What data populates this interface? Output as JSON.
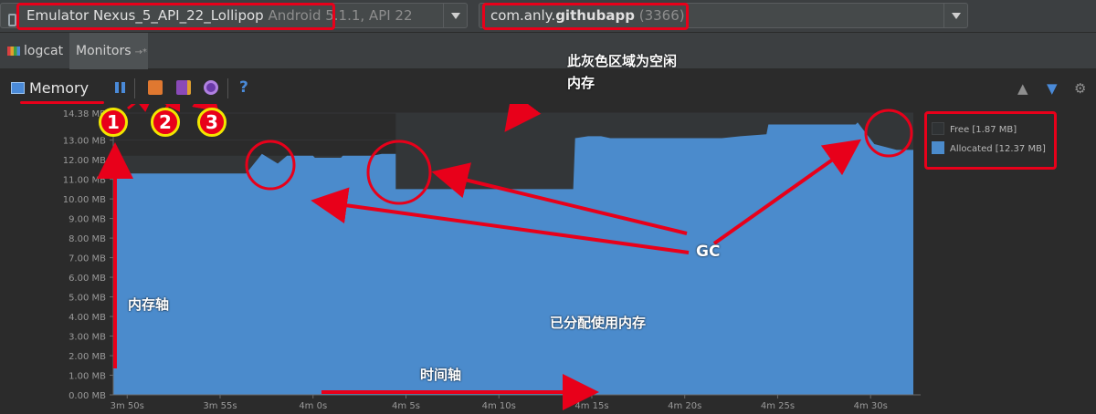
{
  "device_combo": {
    "name": "Emulator Nexus_5_API_22_Lollipop",
    "version": "Android 5.1.1, API 22"
  },
  "process_combo": {
    "prefix": "com.anly.",
    "bold": "githubapp",
    "pid": "(3366)"
  },
  "tabs": {
    "logcat": "logcat",
    "monitors": "Monitors",
    "monitors_pin": "→*"
  },
  "memory_label": "Memory",
  "help_label": "?",
  "legend": {
    "free": "Free [1.87 MB]",
    "allocated": "Allocated [12.37 MB]"
  },
  "annotations": {
    "idle_line1": "此灰色区域为空闲",
    "idle_line2": "内存",
    "gc": "GC",
    "memory_axis": "内存轴",
    "allocated_memory": "已分配使用内存",
    "time_axis": "时间轴",
    "circle_1": "1",
    "circle_2": "2",
    "circle_3": "3"
  },
  "colors": {
    "free": "#333638",
    "allocated": "#4b8bcc",
    "highlight": "#e8001a",
    "background": "#2b2b2b"
  },
  "chart_data": {
    "type": "area",
    "ylim": [
      0,
      14.38
    ],
    "yticks": [
      "0.00 MB",
      "1.00 MB",
      "2.00 MB",
      "3.00 MB",
      "4.00 MB",
      "5.00 MB",
      "6.00 MB",
      "7.00 MB",
      "8.00 MB",
      "9.00 MB",
      "10.00 MB",
      "11.00 MB",
      "12.00 MB",
      "13.00 MB",
      "14.38 MB"
    ],
    "ytick_values": [
      0,
      1,
      2,
      3,
      4,
      5,
      6,
      7,
      8,
      9,
      10,
      11,
      12,
      13,
      14.38
    ],
    "xlim": [
      -10.75,
      32.3
    ],
    "xticks": [
      "3m 50s",
      "3m 55s",
      "4m 0s",
      "4m 5s",
      "4m 10s",
      "4m 15s",
      "4m 20s",
      "4m 25s",
      "4m 30s"
    ],
    "xtick_values": [
      -10,
      -5,
      0,
      5,
      10,
      15,
      20,
      25,
      30
    ],
    "series": [
      {
        "name": "Free",
        "x": [
          -10.75,
          4.45,
          4.45,
          14.1,
          14.1,
          32.3
        ],
        "values": [
          12.2,
          12.2,
          14.38,
          14.38,
          14.38,
          14.38
        ]
      },
      {
        "name": "Allocated",
        "x": [
          -10.75,
          -10.4,
          -7.8,
          -5.8,
          -3.6,
          -2.75,
          -1.9,
          -1.4,
          -1.0,
          0.0,
          0.1,
          1.5,
          1.6,
          2.2,
          2.7,
          3.2,
          3.7,
          4.45,
          4.45,
          6.5,
          6.6,
          7.5,
          8.8,
          8.9,
          10.0,
          10.1,
          11.2,
          11.3,
          12.3,
          12.4,
          14.0,
          14.1,
          14.8,
          15.5,
          16.0,
          17.0,
          18.0,
          19.0,
          20.0,
          21.0,
          22.0,
          23.0,
          24.4,
          24.5,
          25.0,
          26.0,
          27.0,
          28.0,
          29.2,
          29.3,
          30.2,
          31.4,
          31.5,
          32.3
        ],
        "values": [
          12.0,
          11.3,
          11.3,
          11.3,
          11.3,
          12.3,
          11.8,
          12.2,
          12.2,
          12.2,
          12.1,
          12.1,
          12.2,
          12.2,
          12.2,
          12.2,
          12.3,
          12.3,
          10.5,
          10.5,
          10.5,
          10.5,
          10.5,
          10.5,
          10.5,
          10.5,
          10.5,
          10.5,
          10.5,
          10.5,
          10.5,
          13.1,
          13.2,
          13.2,
          13.1,
          13.1,
          13.1,
          13.1,
          13.1,
          13.1,
          13.1,
          13.2,
          13.3,
          13.8,
          13.8,
          13.8,
          13.8,
          13.8,
          13.8,
          13.9,
          12.8,
          12.5,
          12.5,
          12.5
        ]
      }
    ]
  }
}
